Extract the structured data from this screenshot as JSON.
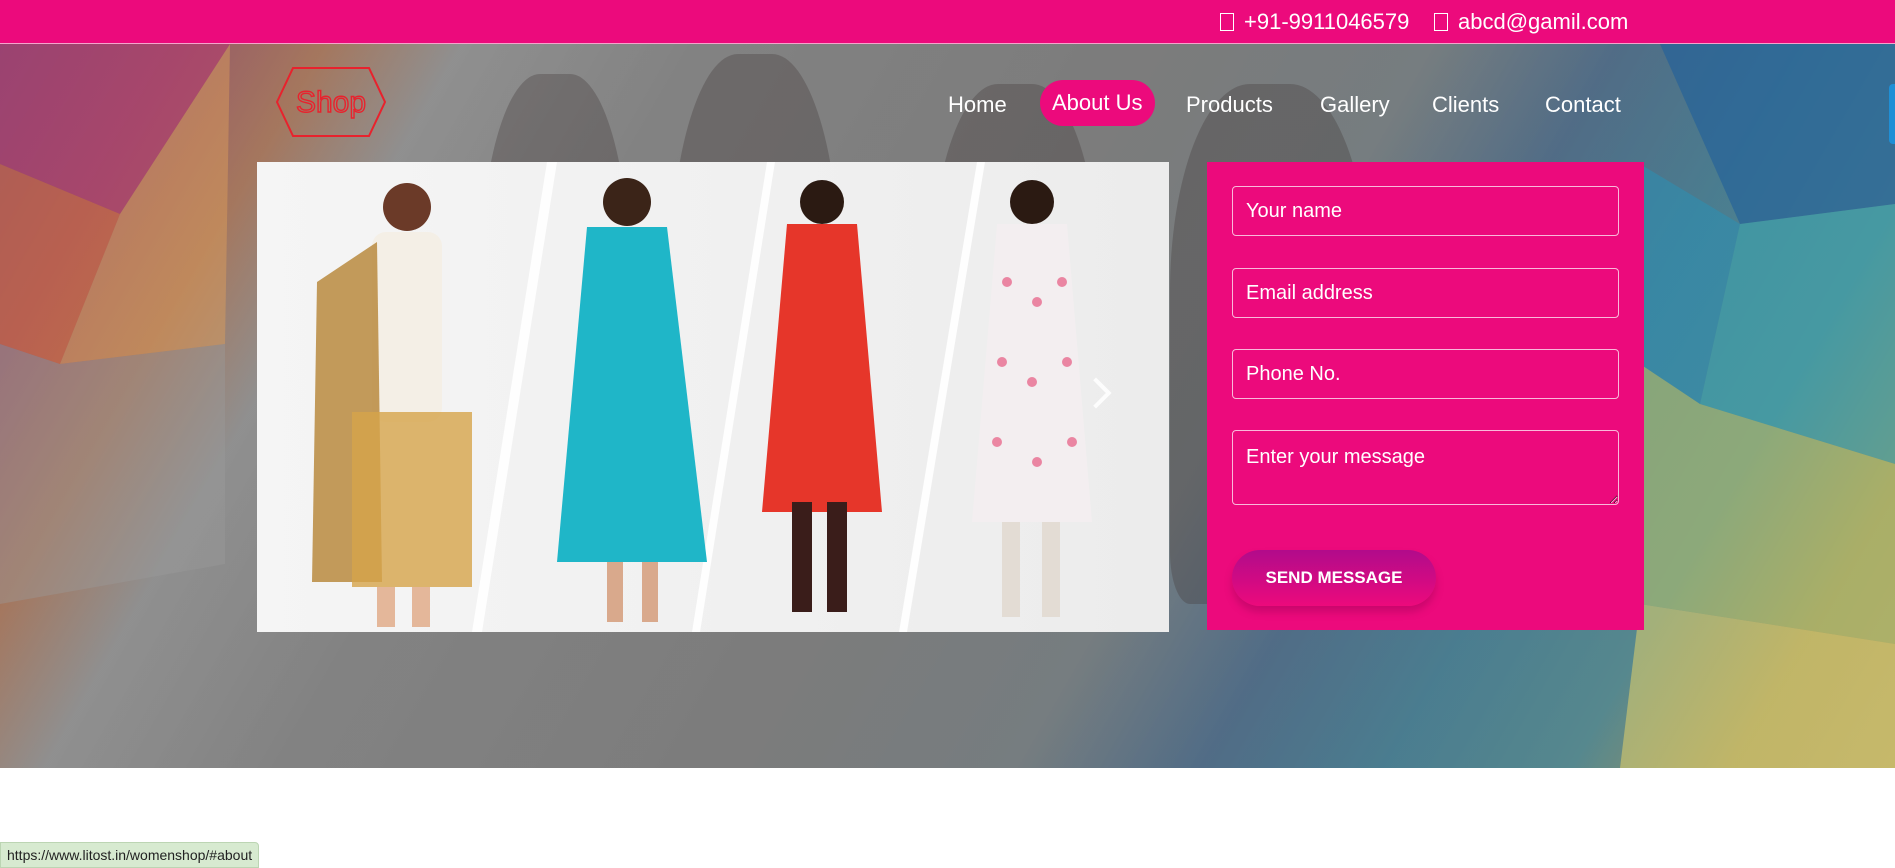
{
  "topbar": {
    "phone": "+91-9911046579",
    "email": "abcd@gamil.com",
    "phone_icon": "phone-icon",
    "email_icon": "envelope-icon",
    "color": "#ec0a7c"
  },
  "logo": {
    "text": "Shop",
    "color": "#e8222d"
  },
  "nav": {
    "items": [
      {
        "label": "Home"
      },
      {
        "label": "About Us",
        "active": true
      },
      {
        "label": "Products"
      },
      {
        "label": "Gallery"
      },
      {
        "label": "Clients"
      },
      {
        "label": "Contact"
      }
    ]
  },
  "slider": {
    "next_icon": "chevron-right-icon"
  },
  "form": {
    "name_placeholder": "Your name",
    "email_placeholder": "Email address",
    "phone_placeholder": "Phone No.",
    "message_placeholder": "Enter your message",
    "submit_label": "SEND MESSAGE"
  },
  "status_url": "https://www.litost.in/womenshop/#about"
}
